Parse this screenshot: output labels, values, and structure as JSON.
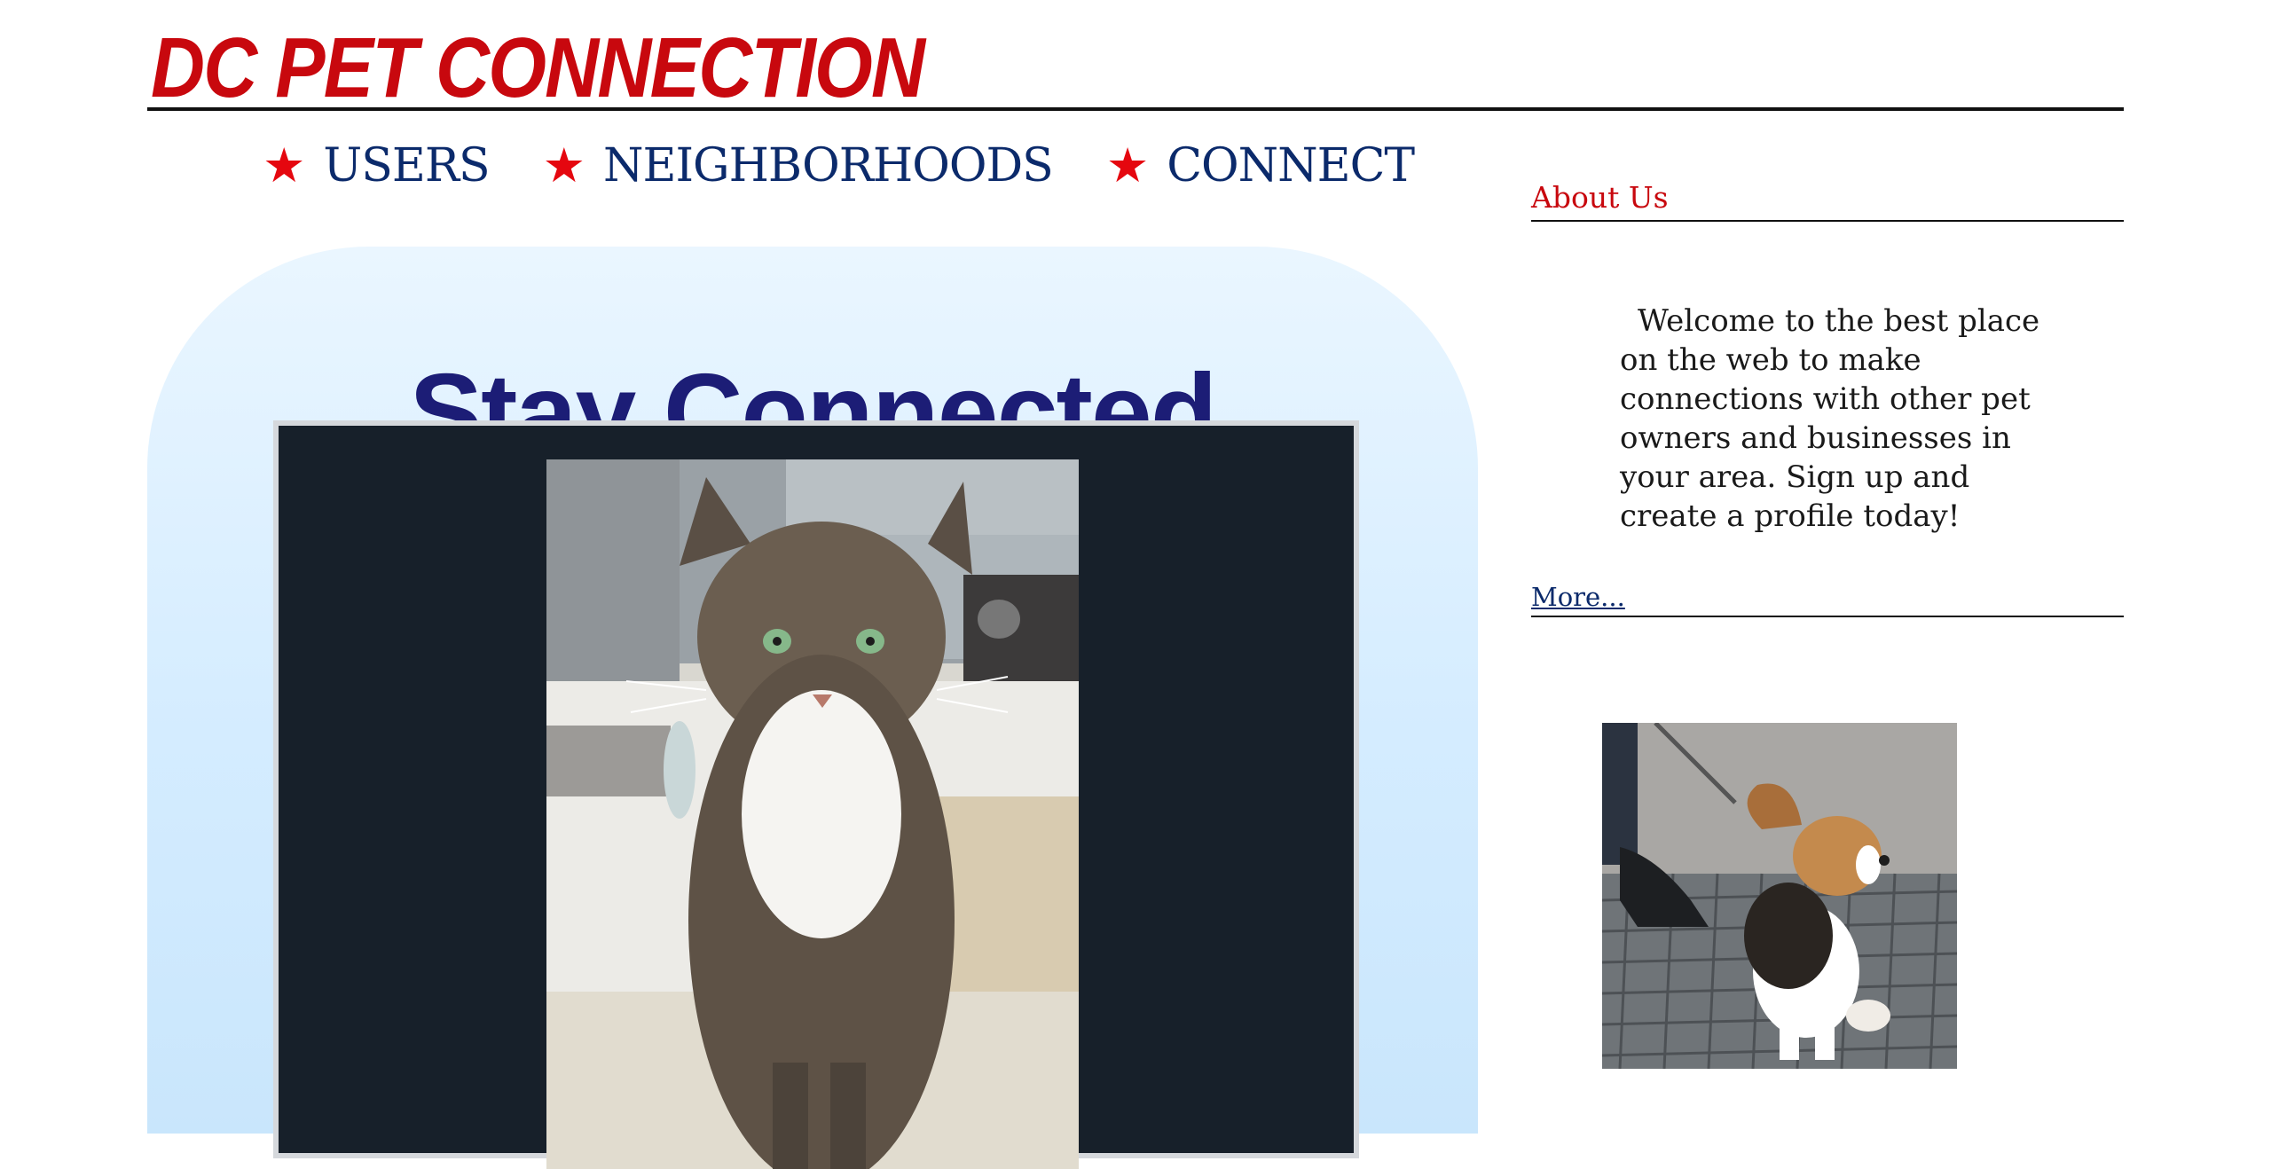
{
  "header": {
    "site_title": "DC PET CONNECTION"
  },
  "nav": {
    "items": [
      {
        "label": "USERS",
        "icon": "star-icon"
      },
      {
        "label": "NEIGHBORHOODS",
        "icon": "star-icon"
      },
      {
        "label": "CONNECT",
        "icon": "star-icon"
      }
    ],
    "star_glyph": "★"
  },
  "hero": {
    "title": "Stay Connected"
  },
  "aside": {
    "about_title": "About Us",
    "about_text": "Welcome to the best place on the web to make connections with other pet owners and businesses in your area. Sign up and create a profile today!",
    "more_label": "More..."
  },
  "colors": {
    "brand_red": "#c8080e",
    "nav_blue": "#0b2a6b",
    "hero_title": "#1c1d76",
    "hero_bg": "#d4ecff",
    "slide_bg": "#17202a"
  }
}
